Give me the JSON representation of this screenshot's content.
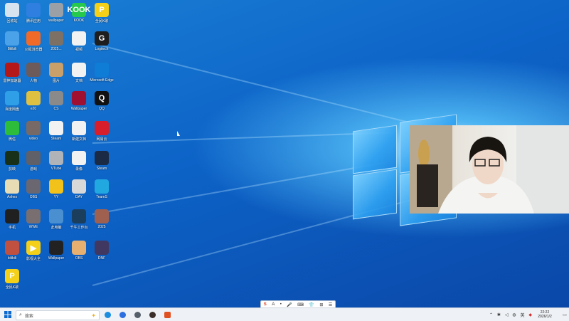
{
  "colors": {
    "accent": "#1478d4",
    "taskbar": "#eef1f5"
  },
  "desktop_icons": [
    {
      "label": "回收站",
      "icon": "recycle-bin-icon",
      "color": "#d7e3ef"
    },
    {
      "label": "腾讯应用",
      "icon": "blue-app-icon",
      "color": "#2f7fe0"
    },
    {
      "label": "wallpaper",
      "icon": "photo-icon",
      "color": "#9aa0a6"
    },
    {
      "label": "KOOK",
      "icon": "kook-icon",
      "color": "#26c94b",
      "text": "KOOK"
    },
    {
      "label": "全民K歌",
      "icon": "yellow-app-icon",
      "color": "#f4d018",
      "text": "P"
    },
    {
      "label": "Bilibili",
      "icon": "bilibili-icon",
      "color": "#4ca2e8"
    },
    {
      "label": "火狐浏览器",
      "icon": "orange-app-icon",
      "color": "#f16a28"
    },
    {
      "label": "2025...",
      "icon": "photo-icon",
      "color": "#7d7166"
    },
    {
      "label": "视频",
      "icon": "video-icon",
      "color": "#f2f2f2"
    },
    {
      "label": "Logitech",
      "icon": "logitech-icon",
      "color": "#1e1e1e",
      "text": "G"
    },
    {
      "label": "雷神加速器",
      "icon": "red-app-icon",
      "color": "#b41818"
    },
    {
      "label": "人物",
      "icon": "photo-icon",
      "color": "#6d5a5a"
    },
    {
      "label": "图片",
      "icon": "photo-icon",
      "color": "#c9a06a"
    },
    {
      "label": "文档",
      "icon": "file-icon",
      "color": "#f2f2f2"
    },
    {
      "label": "Microsoft Edge",
      "icon": "edge-icon",
      "color": "#0f7cd6"
    },
    {
      "label": "百度网盘",
      "icon": "globe-icon",
      "color": "#2fa0e8"
    },
    {
      "label": "e20",
      "icon": "photo-icon",
      "color": "#e0c040"
    },
    {
      "label": "CS",
      "icon": "photo-icon",
      "color": "#8a8a8a"
    },
    {
      "label": "Wallpaper",
      "icon": "wallpaper-icon",
      "color": "#a01030"
    },
    {
      "label": "QQ",
      "icon": "qq-icon",
      "color": "#111111",
      "text": "Q"
    },
    {
      "label": "微信",
      "icon": "wechat-icon",
      "color": "#2dbd3a"
    },
    {
      "label": "video",
      "icon": "photo-icon",
      "color": "#776a66"
    },
    {
      "label": "Steam",
      "icon": "shield-icon",
      "color": "#f2f2f2"
    },
    {
      "label": "新建文档",
      "icon": "file-icon",
      "color": "#f2f2f2"
    },
    {
      "label": "网易云",
      "icon": "netease-icon",
      "color": "#d81e2b"
    },
    {
      "label": "剪映",
      "icon": "green-app-icon",
      "color": "#183018"
    },
    {
      "label": "游戏",
      "icon": "photo-icon",
      "color": "#5f6068"
    },
    {
      "label": "VTube",
      "icon": "photo-icon",
      "color": "#b0b4b8"
    },
    {
      "label": "录像",
      "icon": "video-icon",
      "color": "#f2f2f2"
    },
    {
      "label": "Steam",
      "icon": "steam-icon",
      "color": "#1b2a45"
    },
    {
      "label": "Ashes",
      "icon": "bird-icon",
      "color": "#e8dcb4"
    },
    {
      "label": "OBS",
      "icon": "photo-icon",
      "color": "#6a6770"
    },
    {
      "label": "YY",
      "icon": "yy-icon",
      "color": "#f3c21a"
    },
    {
      "label": "DAY",
      "icon": "photo-icon",
      "color": "#d8d8d8"
    },
    {
      "label": "TeamS",
      "icon": "teams-icon",
      "color": "#22a8e0"
    },
    {
      "label": "手机",
      "icon": "phone-icon",
      "color": "#202020"
    },
    {
      "label": "WWE",
      "icon": "photo-icon",
      "color": "#7a6f70"
    },
    {
      "label": "此电脑",
      "icon": "computer-icon",
      "color": "#4a90d0"
    },
    {
      "label": "千牛工作台",
      "icon": "teal-app-icon",
      "color": "#1a3e5c"
    },
    {
      "label": "2025",
      "icon": "photo-icon",
      "color": "#a06050"
    },
    {
      "label": "bilibili",
      "icon": "photo-icon",
      "color": "#c05040"
    },
    {
      "label": "影视大全",
      "icon": "yellow-app-icon",
      "color": "#f4d018",
      "text": "▶"
    },
    {
      "label": "Wallpaper",
      "icon": "dark-app-icon",
      "color": "#222222"
    },
    {
      "label": "OBS",
      "icon": "photo-icon",
      "color": "#e8b070"
    },
    {
      "label": "DNF",
      "icon": "photo-icon",
      "color": "#403860"
    },
    {
      "label": "全民K歌",
      "icon": "yellow-app-icon",
      "color": "#f4d018",
      "text": "P"
    }
  ],
  "taskbar": {
    "search_placeholder": "搜索",
    "time": "22:22",
    "date": "2026/1/2",
    "apps": [
      "edge-icon",
      "chrome-icon",
      "settings-icon",
      "bear-icon",
      "fire-icon"
    ]
  },
  "ime_toolbar": {
    "items": [
      "S",
      "A",
      "•",
      "🎤",
      "⌨",
      "👕",
      "⊞",
      "☰"
    ]
  }
}
